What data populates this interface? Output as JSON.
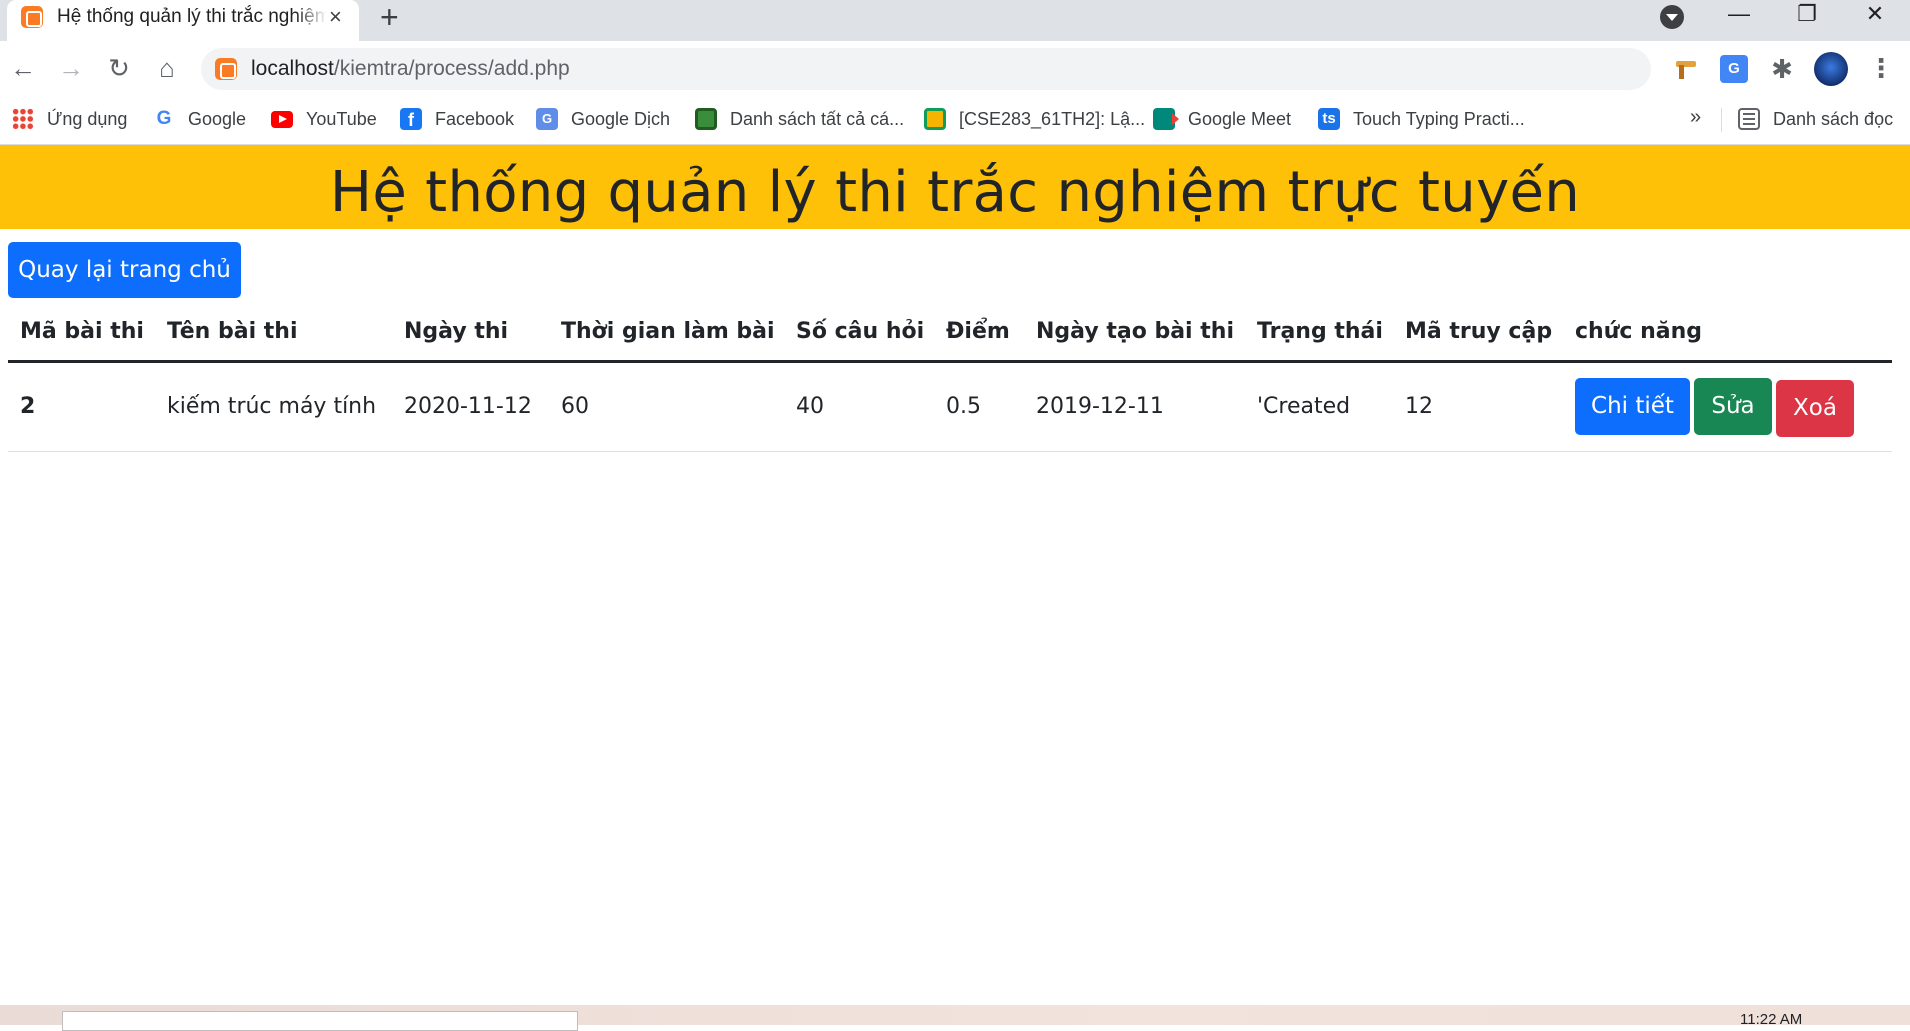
{
  "browser": {
    "tab_title": "Hệ thống quản lý thi trắc nghiệm trực tuyến",
    "close_glyph": "×",
    "new_tab_glyph": "+",
    "window_controls": {
      "minimize": "—",
      "restore": "❐",
      "close": "✕"
    },
    "nav": {
      "back": "←",
      "forward": "→",
      "reload": "↻",
      "home": "⌂"
    },
    "url_host": "localhost",
    "url_path": "/kiemtra/process/add.php",
    "menu_glyph": "⋮",
    "puzzle_glyph": "✱",
    "translate_glyph": "G"
  },
  "bookmarks": [
    {
      "label": "Ứng dụng",
      "icon": "apps-grid-icon"
    },
    {
      "label": "Google",
      "icon": "google-icon"
    },
    {
      "label": "YouTube",
      "icon": "youtube-icon"
    },
    {
      "label": "Facebook",
      "icon": "facebook-icon"
    },
    {
      "label": "Google Dịch",
      "icon": "google-translate-icon"
    },
    {
      "label": "Danh sách tất cả cá...",
      "icon": "green-ball-icon"
    },
    {
      "label": "[CSE283_61TH2]: Lậ...",
      "icon": "classroom-icon"
    },
    {
      "label": "Google Meet",
      "icon": "google-meet-icon"
    },
    {
      "label": "Touch Typing Practi...",
      "icon": "typing-ts-icon"
    }
  ],
  "bookmarks_more": "»",
  "reading_list": "Danh sách đọc",
  "page": {
    "title": "Hệ thống quản lý thi trắc nghiệm trực tuyến",
    "back_home_button": "Quay lại trang chủ",
    "table": {
      "headers": [
        "Mã bài thi",
        "Tên bài thi",
        "Ngày thi",
        "Thời gian làm bài",
        "Số câu hỏi",
        "Điểm",
        "Ngày tạo bài thi",
        "Trạng thái",
        "Mã truy cập",
        "chức năng"
      ],
      "rows": [
        {
          "id": "2",
          "name": "kiếm trúc máy tính",
          "exam_date": "2020-11-12",
          "duration": "60",
          "questions": "40",
          "score": "0.5",
          "created_date": "2019-12-11",
          "status": "'Created",
          "access_code": "12",
          "actions": {
            "detail": "Chi tiết",
            "edit": "Sửa",
            "delete": "Xoá"
          }
        }
      ]
    }
  },
  "taskbar": {
    "clock": "11:22 AM"
  },
  "colors": {
    "banner": "#ffc107",
    "primary": "#0d6efd",
    "success": "#198754",
    "danger": "#dc3545"
  }
}
